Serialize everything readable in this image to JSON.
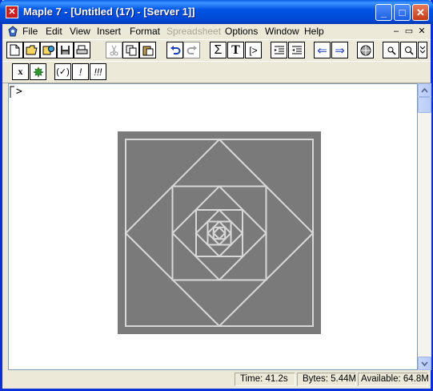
{
  "window": {
    "title": "Maple 7  - [Untitled (17) - [Server 1]]",
    "app_icon_glyph": "✕",
    "minimize_glyph": "_",
    "maximize_glyph": "□",
    "close_glyph": "✕"
  },
  "menubar": {
    "items": [
      {
        "label": "File",
        "enabled": true
      },
      {
        "label": "Edit",
        "enabled": true
      },
      {
        "label": "View",
        "enabled": true
      },
      {
        "label": "Insert",
        "enabled": true
      },
      {
        "label": "Format",
        "enabled": true
      },
      {
        "label": "Spreadsheet",
        "enabled": false
      },
      {
        "label": "Options",
        "enabled": true
      },
      {
        "label": "Window",
        "enabled": true
      },
      {
        "label": "Help",
        "enabled": true
      }
    ],
    "doc_minimize": "–",
    "doc_restore": "▭",
    "doc_close": "✕"
  },
  "toolbar": {
    "sigma_label": "Σ",
    "text_label": "T",
    "prompt_label": "[>",
    "back_glyph": "⇐",
    "forward_glyph": "⇒"
  },
  "context_bar": {
    "x_label": "x",
    "leaf_icon": "maple-leaf-icon",
    "check_label": "(✓)",
    "eval_label": "!",
    "eval_all_label": "!!!"
  },
  "worksheet": {
    "prompt": ">",
    "plot": {
      "background": "#7a7a7a",
      "line_color": "#d8d8d8"
    }
  },
  "statusbar": {
    "time": "Time:  41.2s",
    "bytes": "Bytes: 5.44M",
    "available": "Available: 64.8M"
  },
  "colors": {
    "title_blue": "#0055e5",
    "chrome": "#ece9d8"
  }
}
